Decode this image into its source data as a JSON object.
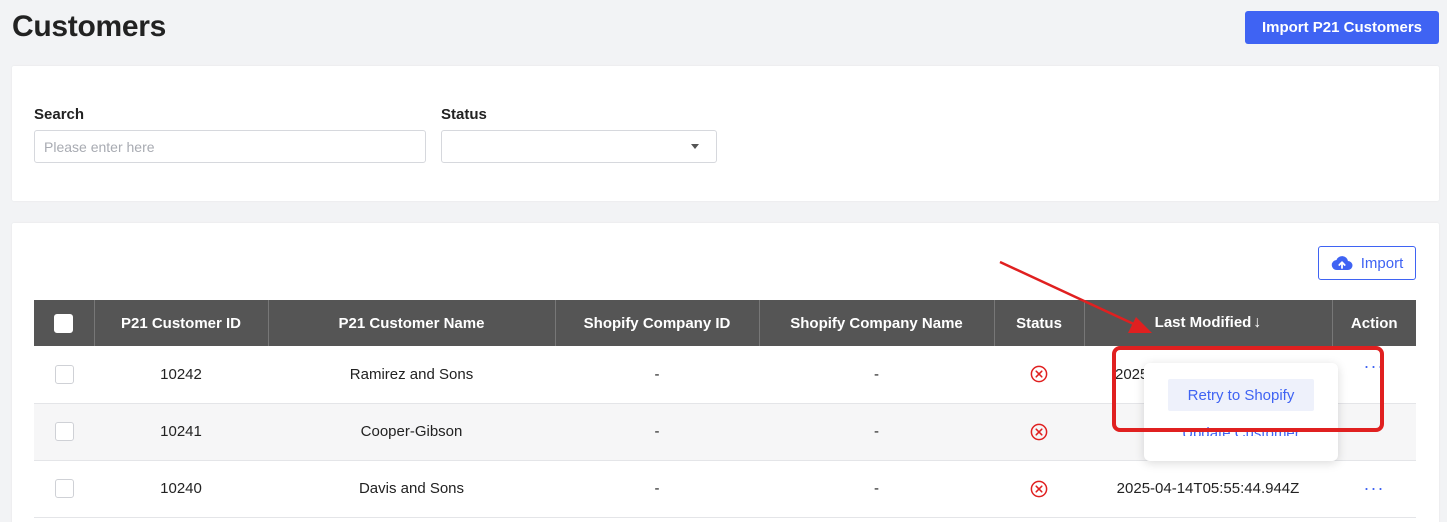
{
  "header": {
    "title": "Customers",
    "import_p21_label": "Import P21 Customers"
  },
  "filters": {
    "search_label": "Search",
    "search_placeholder": "Please enter here",
    "search_value": "",
    "status_label": "Status",
    "status_value": ""
  },
  "toolbar": {
    "import_label": "Import",
    "import_icon": "cloud-upload-icon"
  },
  "table": {
    "columns": [
      "P21 Customer ID",
      "P21 Customer Name",
      "Shopify Company ID",
      "Shopify Company Name",
      "Status",
      "Last Modified",
      "Action"
    ],
    "sort_icon": "arrow-down-icon",
    "rows": [
      {
        "id": "10242",
        "name": "Ramirez and Sons",
        "shopify_id": "-",
        "shopify_name": "-",
        "status": "error",
        "last_modified": "2025",
        "action": "···"
      },
      {
        "id": "10241",
        "name": "Cooper-Gibson",
        "shopify_id": "-",
        "shopify_name": "-",
        "status": "error",
        "last_modified": "",
        "action": ""
      },
      {
        "id": "10240",
        "name": "Davis and Sons",
        "shopify_id": "-",
        "shopify_name": "-",
        "status": "error",
        "last_modified": "2025-04-14T05:55:44.944Z",
        "action": "···"
      }
    ]
  },
  "action_menu": {
    "items": [
      "Retry to Shopify",
      "Update Customer"
    ]
  },
  "colors": {
    "primary": "#3f63f3",
    "header_bg": "#555555",
    "error": "#e02020",
    "annotation": "#e02020"
  }
}
